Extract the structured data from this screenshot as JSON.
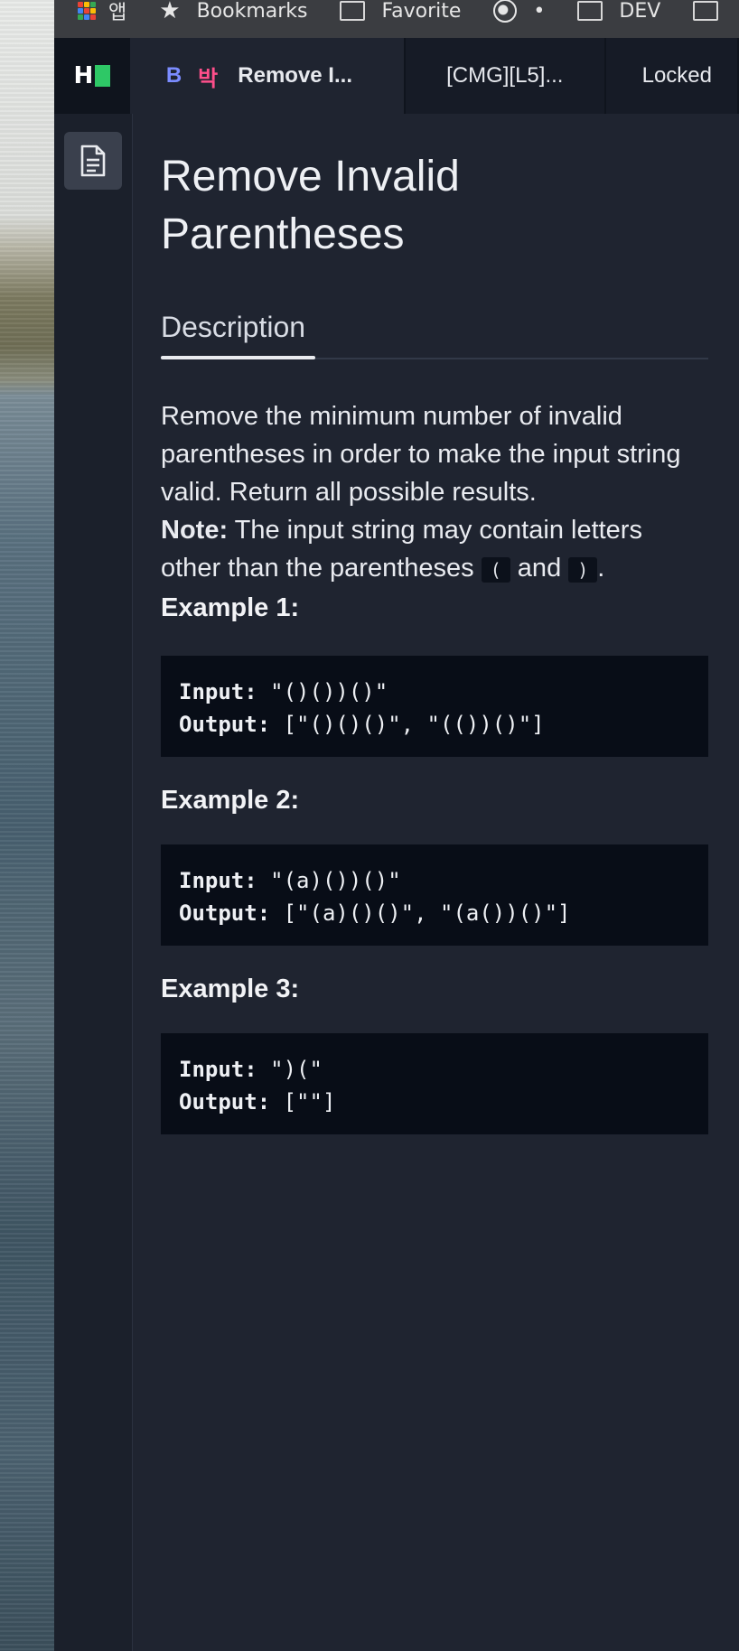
{
  "bookmarks_bar": {
    "items": [
      {
        "label": "앱",
        "icon": "apps-grid-icon"
      },
      {
        "label": "Bookmarks",
        "icon": "star-icon"
      },
      {
        "label": "Favorite",
        "icon": "folder-icon"
      },
      {
        "label": "•",
        "icon": "globe-icon"
      },
      {
        "label": "DEV",
        "icon": "folder-icon"
      }
    ]
  },
  "app": {
    "logo_letter": "H",
    "tabs": [
      {
        "prefix_b": "B",
        "prefix_k": "박",
        "label": "Remove I..."
      },
      {
        "label": "[CMG][L5]..."
      },
      {
        "label": "Locked"
      }
    ],
    "sidebar": {
      "icon": "document-icon"
    }
  },
  "problem": {
    "title": "Remove Invalid Parentheses",
    "tab_label": "Description",
    "desc_line": "Remove the minimum number of invalid parentheses in order to make the input string valid. Return all possible results.",
    "note_label": "Note:",
    "note_text_a": " The input string may contain letters other than the parentheses ",
    "note_code_1": "(",
    "note_text_b": " and ",
    "note_code_2": ")",
    "note_text_c": ".",
    "examples": [
      {
        "heading": "Example 1:",
        "input_label": "Input:",
        "input": " \"()())()\"",
        "output_label": "Output:",
        "output": " [\"()()()\", \"(())()\"]"
      },
      {
        "heading": "Example 2:",
        "input_label": "Input:",
        "input": " \"(a)())()\"",
        "output_label": "Output:",
        "output": " [\"(a)()()\", \"(a())()\"]"
      },
      {
        "heading": "Example 3:",
        "input_label": "Input:",
        "input": " \")(\"",
        "output_label": "Output:",
        "output": " [\"\"]"
      }
    ]
  },
  "colors": {
    "accent_green": "#2ec866",
    "b_prefix": "#7b8cff",
    "k_prefix": "#ff4f8b",
    "panel_bg": "#1f2430",
    "code_bg": "#080d17"
  }
}
